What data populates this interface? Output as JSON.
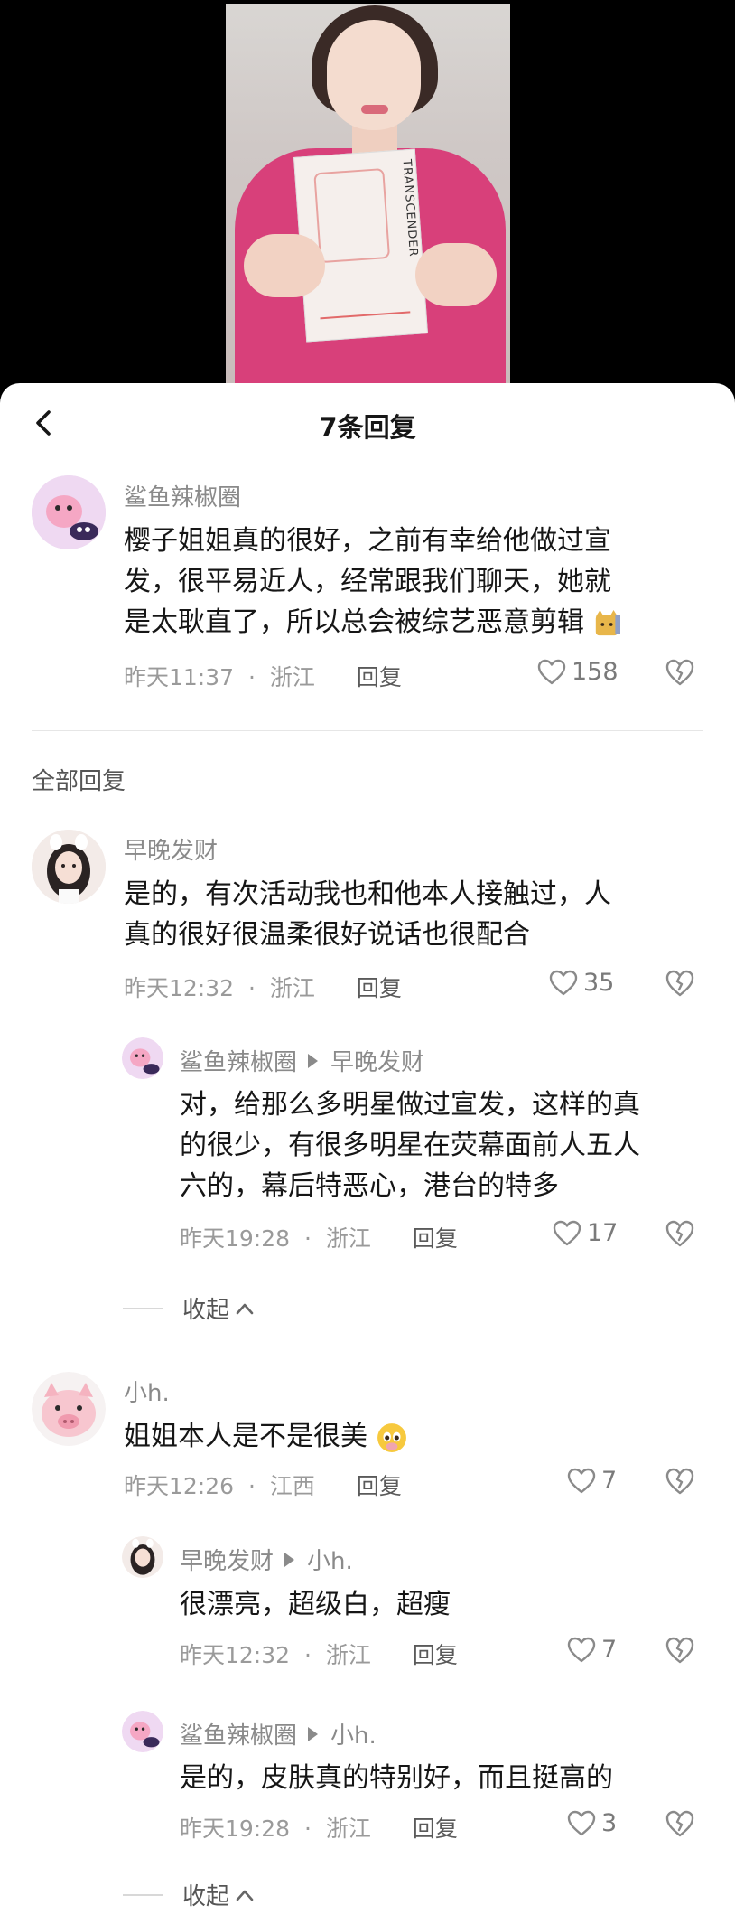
{
  "video": {
    "card_brand_text": "TRANSCENDER"
  },
  "header": {
    "title": "7条回复",
    "back_icon": "chevron-left-icon"
  },
  "root_comment": {
    "author": "鲨鱼辣椒圈",
    "text": "樱子姐姐真的很好，之前有幸给他做过宣发，很平易近人，经常跟我们聊天，她就是太耿直了，所以总会被综艺恶意剪辑",
    "text_lines": [
      "樱子姐姐真的很好，之前有幸给他做过宣",
      "发，很平易近人，经常跟我们聊天，她就",
      "是太耿直了，所以总会被综艺恶意剪辑"
    ],
    "trailing_emoji": "cat-sweat-emoji",
    "time": "昨天11:37",
    "location": "浙江",
    "reply_label": "回复",
    "likes": "158"
  },
  "section_label": "全部回复",
  "threads": [
    {
      "author": "早晚发财",
      "text_lines": [
        "是的，有次活动我也和他本人接触过，人",
        "真的很好很温柔很好说话也很配合"
      ],
      "time": "昨天12:32",
      "location": "浙江",
      "reply_label": "回复",
      "likes": "35",
      "replies": [
        {
          "author": "鲨鱼辣椒圈",
          "reply_to": "早晚发财",
          "text_lines": [
            "对，给那么多明星做过宣发，这样的真",
            "的很少，有很多明星在荧幕面前人五人",
            "六的，幕后特恶心，港台的特多"
          ],
          "time": "昨天19:28",
          "location": "浙江",
          "reply_label": "回复",
          "likes": "17"
        }
      ],
      "collapse_label": "收起"
    },
    {
      "author": "小h.",
      "text": "姐姐本人是不是很美",
      "trailing_emoji": "pleading-face-emoji",
      "time": "昨天12:26",
      "location": "江西",
      "reply_label": "回复",
      "likes": "7",
      "replies": [
        {
          "author": "早晚发财",
          "reply_to": "小h.",
          "text_lines": [
            "很漂亮，超级白，超瘦"
          ],
          "time": "昨天12:32",
          "location": "浙江",
          "reply_label": "回复",
          "likes": "7"
        },
        {
          "author": "鲨鱼辣椒圈",
          "reply_to": "小h.",
          "text_lines": [
            "是的，皮肤真的特别好，而且挺高的"
          ],
          "time": "昨天19:28",
          "location": "浙江",
          "reply_label": "回复",
          "likes": "3"
        }
      ],
      "collapse_label": "收起"
    }
  ],
  "meta_separator": "·",
  "colors": {
    "accent_pink": "#d8407a",
    "text_primary": "#161616",
    "text_secondary": "#8a8a8a"
  }
}
